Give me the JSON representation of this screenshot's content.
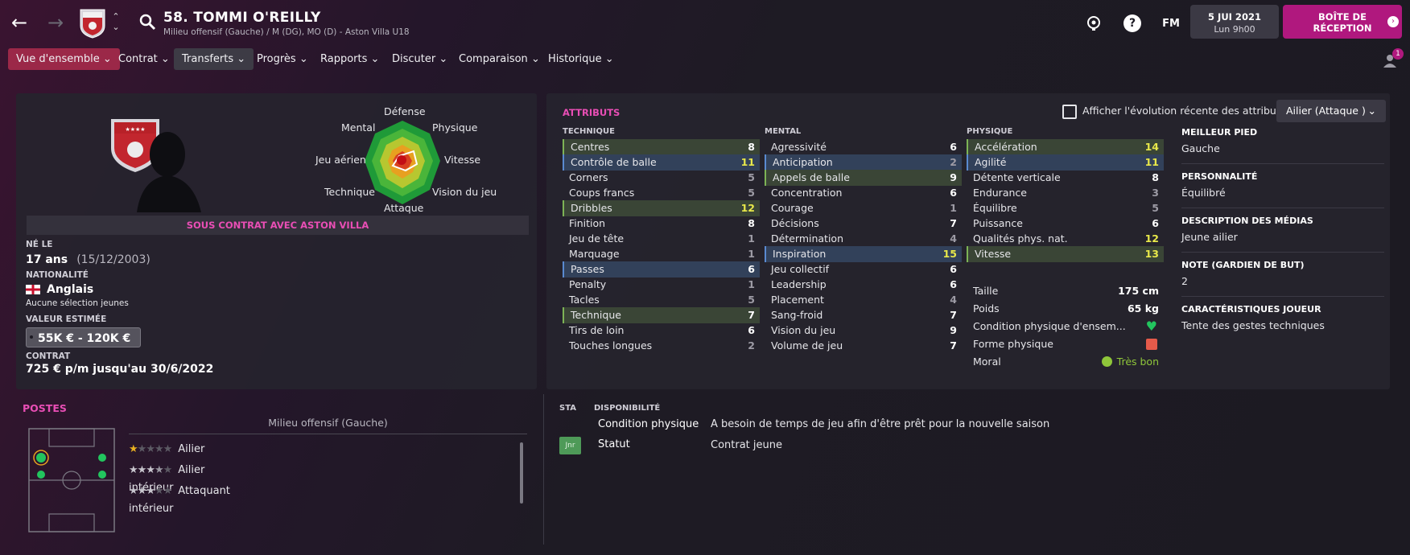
{
  "header": {
    "player_title": "58. TOMMI O'REILLY",
    "player_subtitle": "Milieu offensif (Gauche) / M (DG), MO (D) - Aston Villa U18",
    "fm_label": "FM",
    "date_main": "5 JUI 2021",
    "date_sub": "Lun 9h00",
    "inbox_label_1": "BOÎTE DE",
    "inbox_label_2": "RÉCEPTION",
    "notification_count": "1"
  },
  "menu": [
    {
      "label": "Vue d'ensemble"
    },
    {
      "label": "Contrat"
    },
    {
      "label": "Transferts"
    },
    {
      "label": "Progrès"
    },
    {
      "label": "Rapports"
    },
    {
      "label": "Discuter"
    },
    {
      "label": "Comparaison"
    },
    {
      "label": "Historique"
    }
  ],
  "profile": {
    "contract_banner": "SOUS CONTRAT AVEC ASTON VILLA",
    "born_label": "NÉ LE",
    "age": "17 ans",
    "dob": "(15/12/2003)",
    "nationality_label": "NATIONALITÉ",
    "nationality": "Anglais",
    "caps": "Aucune sélection jeunes",
    "value_label": "VALEUR ESTIMÉE",
    "value": "55K € - 120K €",
    "contract_label": "CONTRAT",
    "contract": "725 € p/m jusqu'au 30/6/2022"
  },
  "radar": {
    "labels": [
      "Défense",
      "Physique",
      "Vitesse",
      "Vision du jeu",
      "Attaque",
      "Technique",
      "Jeu aérien",
      "Mental"
    ]
  },
  "attributes": {
    "title": "ATTRIBUTS",
    "toggle_label": "Afficher l'évolution récente des attributs",
    "role_select": "Ailier (Attaque )",
    "technique_head": "TECHNIQUE",
    "mental_head": "MENTAL",
    "physique_head": "PHYSIQUE",
    "technique": [
      {
        "name": "Centres",
        "value": "8"
      },
      {
        "name": "Contrôle de balle",
        "value": "11"
      },
      {
        "name": "Corners",
        "value": "5"
      },
      {
        "name": "Coups francs",
        "value": "5"
      },
      {
        "name": "Dribbles",
        "value": "12"
      },
      {
        "name": "Finition",
        "value": "8"
      },
      {
        "name": "Jeu de tête",
        "value": "1"
      },
      {
        "name": "Marquage",
        "value": "1"
      },
      {
        "name": "Passes",
        "value": "6"
      },
      {
        "name": "Penalty",
        "value": "1"
      },
      {
        "name": "Tacles",
        "value": "5"
      },
      {
        "name": "Technique",
        "value": "7"
      },
      {
        "name": "Tirs de loin",
        "value": "6"
      },
      {
        "name": "Touches longues",
        "value": "2"
      }
    ],
    "mental": [
      {
        "name": "Agressivité",
        "value": "6"
      },
      {
        "name": "Anticipation",
        "value": "2"
      },
      {
        "name": "Appels de balle",
        "value": "9"
      },
      {
        "name": "Concentration",
        "value": "6"
      },
      {
        "name": "Courage",
        "value": "1"
      },
      {
        "name": "Décisions",
        "value": "7"
      },
      {
        "name": "Détermination",
        "value": "4"
      },
      {
        "name": "Inspiration",
        "value": "15"
      },
      {
        "name": "Jeu collectif",
        "value": "6"
      },
      {
        "name": "Leadership",
        "value": "6"
      },
      {
        "name": "Placement",
        "value": "4"
      },
      {
        "name": "Sang-froid",
        "value": "7"
      },
      {
        "name": "Vision du jeu",
        "value": "9"
      },
      {
        "name": "Volume de jeu",
        "value": "7"
      }
    ],
    "physique": [
      {
        "name": "Accélération",
        "value": "14"
      },
      {
        "name": "Agilité",
        "value": "11"
      },
      {
        "name": "Détente verticale",
        "value": "8"
      },
      {
        "name": "Endurance",
        "value": "3"
      },
      {
        "name": "Équilibre",
        "value": "5"
      },
      {
        "name": "Puissance",
        "value": "6"
      },
      {
        "name": "Qualités phys. nat.",
        "value": "12"
      },
      {
        "name": "Vitesse",
        "value": "13"
      }
    ],
    "physical_info": {
      "height_label": "Taille",
      "height": "175 cm",
      "weight_label": "Poids",
      "weight": "65 kg",
      "condition_label": "Condition physique d'ensem...",
      "form_label": "Forme physique",
      "morale_label": "Moral",
      "morale": "Très bon"
    }
  },
  "side": [
    {
      "head": "MEILLEUR PIED",
      "value": "Gauche"
    },
    {
      "head": "PERSONNALITÉ",
      "value": "Équilibré"
    },
    {
      "head": "DESCRIPTION DES MÉDIAS",
      "value": "Jeune ailier"
    },
    {
      "head": "NOTE (GARDIEN DE BUT)",
      "value": "2"
    },
    {
      "head": "CARACTÉRISTIQUES JOUEUR",
      "value": "Tente des gestes techniques"
    }
  ],
  "positions": {
    "title": "POSTES",
    "main": "Milieu offensif (Gauche)",
    "roles": [
      {
        "name": "Ailier",
        "stars": 1
      },
      {
        "name": "Ailier intérieur",
        "stars": 3.5
      },
      {
        "name": "Attaquant intérieur",
        "stars": 3
      }
    ]
  },
  "availability": {
    "sta_head": "STA",
    "dispo_head": "DISPONIBILITÉ",
    "badge": "Jnr",
    "rows": [
      {
        "label": "Condition physique",
        "value": "A besoin de temps de jeu afin d'être prêt pour la nouvelle saison"
      },
      {
        "label": "Statut",
        "value": "Contrat jeune"
      }
    ]
  },
  "colors": {
    "accent": "#b0187e",
    "active_tab": "#9b2848",
    "highlight_value": "#e8e84a",
    "good": "#7db356"
  }
}
